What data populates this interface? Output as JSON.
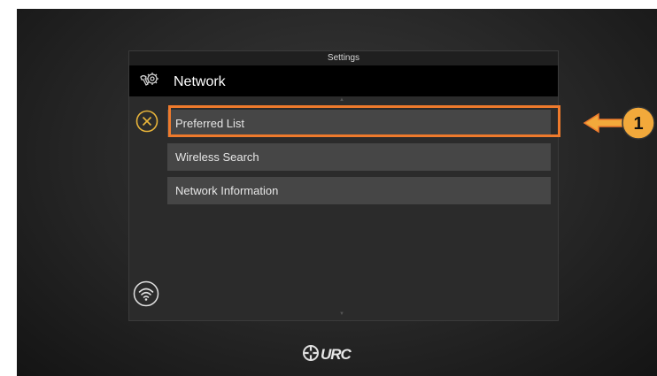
{
  "settings_panel": {
    "title": "Settings",
    "header": {
      "title": "Network",
      "icon": "gear-wrench-icon"
    },
    "menu_items": [
      {
        "label": "Preferred List",
        "selected": true
      },
      {
        "label": "Wireless Search",
        "selected": false
      },
      {
        "label": "Network Information",
        "selected": false
      }
    ],
    "side_icons": [
      "close-circle-icon",
      "wifi-icon"
    ]
  },
  "annotation": {
    "number": "1",
    "color": "#ee7a2c",
    "fill": "#f2a93b"
  },
  "colors": {
    "accent_yellow": "#e8b43a",
    "panel_bg": "#2b2b2b",
    "item_bg": "#464646"
  },
  "brand": {
    "logo": "URC"
  }
}
